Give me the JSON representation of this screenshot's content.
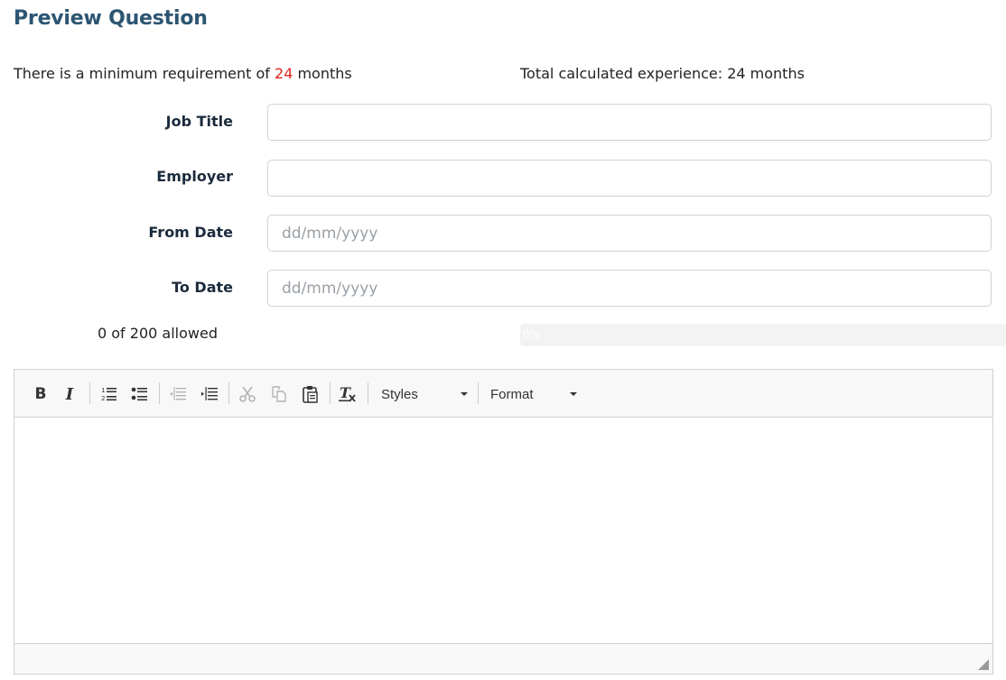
{
  "title": {
    "bold": "Preview",
    "rest": "Question"
  },
  "requirement": {
    "prefix": "There is a minimum requirement of",
    "value": "24",
    "suffix": "months"
  },
  "total": "Total calculated experience: 24 months",
  "fields": {
    "job_title": {
      "label": "Job Title",
      "value": "",
      "placeholder": ""
    },
    "employer": {
      "label": "Employer",
      "value": "",
      "placeholder": ""
    },
    "from_date": {
      "label": "From Date",
      "value": "",
      "placeholder": "dd/mm/yyyy"
    },
    "to_date": {
      "label": "To Date",
      "value": "",
      "placeholder": "dd/mm/yyyy"
    }
  },
  "char_count": "0 of 200 allowed",
  "progress": {
    "percent": 0,
    "label": "0%",
    "color": "#4a90c2"
  },
  "editor": {
    "toolbar": {
      "bold": "B",
      "italic": "I",
      "numbered_list_icon": "numbered-list-icon",
      "bulleted_list_icon": "bulleted-list-icon",
      "outdent_icon": "outdent-icon",
      "indent_icon": "indent-icon",
      "cut_icon": "scissors-icon",
      "copy_icon": "copy-icon",
      "paste_icon": "clipboard-icon",
      "remove_format_icon": "remove-format-icon",
      "styles_label": "Styles",
      "format_label": "Format"
    },
    "content": ""
  },
  "colors": {
    "title": "#2c5572",
    "accent_number": "#e0261c",
    "label": "#1b2b3c"
  }
}
